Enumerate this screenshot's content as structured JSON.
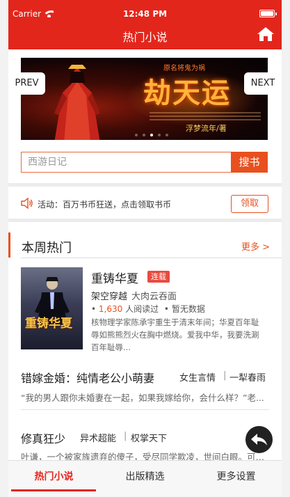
{
  "status_bar": {
    "carrier": "Carrier",
    "time": "12:48 PM"
  },
  "nav": {
    "title": "热门小说",
    "home_icon": "home-icon"
  },
  "banner": {
    "tagline": "原名将鬼为祸",
    "title": "劫天运",
    "author": "浮梦流年/著",
    "prev_label": "PREV",
    "next_label": "NEXT",
    "slide_count": 5,
    "active_slide": 3
  },
  "search": {
    "placeholder": "西游日记",
    "button_label": "搜书"
  },
  "notice": {
    "icon": "speaker-icon",
    "text": "活动：百万书币狂送，点击领取书币",
    "button_label": "领取"
  },
  "section": {
    "title": "本周热门",
    "more_label": "更多 >"
  },
  "featured_book": {
    "cover_title": "重铸华夏",
    "title": "重铸华夏",
    "badge": "连载",
    "category": "架空穿越",
    "author": "大肉云吞面",
    "reads_prefix": "• ",
    "reads_count": "1,630",
    "reads_suffix": " 人阅读过",
    "rating": "• 暂无数据",
    "description": "核物理学家陈承宇重生于清末年间；华夏百年耻辱如熊熊烈火在胸中燃烧。爱我中华，我要洗涮百年耻辱..."
  },
  "books": [
    {
      "title": "错嫁金婚：纯情老公小萌妻",
      "genre": "女生言情",
      "separator": "|",
      "author": "一犁春雨",
      "description": "“我的男人跟你未婚妻在一起，如果我嫁给你，会什么样？”老..."
    },
    {
      "title": "修真狂少",
      "genre": "异术超能",
      "separator": "|",
      "author": "权掌天下",
      "description": "叶谦，一个被家族遗弃的傻子，受尽同学欺凌，世间白眼。可是..."
    }
  ],
  "float_button": {
    "icon": "reply-icon"
  },
  "tabbar": {
    "tabs": [
      {
        "label": "热门小说",
        "active": true
      },
      {
        "label": "出版精选",
        "active": false
      },
      {
        "label": "更多设置",
        "active": false
      }
    ]
  },
  "colors": {
    "brand_red": "#e3261b",
    "accent_orange": "#e8501f"
  }
}
